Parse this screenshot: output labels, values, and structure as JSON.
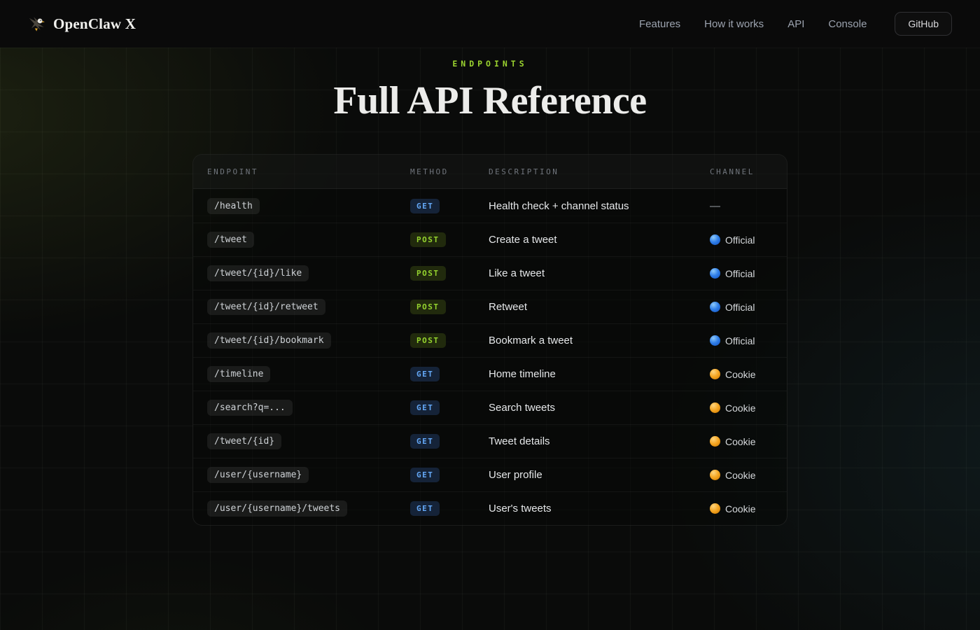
{
  "brand": {
    "name": "OpenClaw X"
  },
  "nav": {
    "links": [
      {
        "label": "Features"
      },
      {
        "label": "How it works"
      },
      {
        "label": "API"
      },
      {
        "label": "Console"
      }
    ],
    "github_label": "GitHub"
  },
  "hero": {
    "eyebrow": "ENDPOINTS",
    "title": "Full API Reference"
  },
  "table": {
    "columns": [
      "ENDPOINT",
      "METHOD",
      "DESCRIPTION",
      "CHANNEL"
    ],
    "rows": [
      {
        "endpoint": "/health",
        "method": "GET",
        "description": "Health check + channel status",
        "channel": "—",
        "channel_type": "none"
      },
      {
        "endpoint": "/tweet",
        "method": "POST",
        "description": "Create a tweet",
        "channel": "Official",
        "channel_type": "official"
      },
      {
        "endpoint": "/tweet/{id}/like",
        "method": "POST",
        "description": "Like a tweet",
        "channel": "Official",
        "channel_type": "official"
      },
      {
        "endpoint": "/tweet/{id}/retweet",
        "method": "POST",
        "description": "Retweet",
        "channel": "Official",
        "channel_type": "official"
      },
      {
        "endpoint": "/tweet/{id}/bookmark",
        "method": "POST",
        "description": "Bookmark a tweet",
        "channel": "Official",
        "channel_type": "official"
      },
      {
        "endpoint": "/timeline",
        "method": "GET",
        "description": "Home timeline",
        "channel": "Cookie",
        "channel_type": "cookie"
      },
      {
        "endpoint": "/search?q=...",
        "method": "GET",
        "description": "Search tweets",
        "channel": "Cookie",
        "channel_type": "cookie"
      },
      {
        "endpoint": "/tweet/{id}",
        "method": "GET",
        "description": "Tweet details",
        "channel": "Cookie",
        "channel_type": "cookie"
      },
      {
        "endpoint": "/user/{username}",
        "method": "GET",
        "description": "User profile",
        "channel": "Cookie",
        "channel_type": "cookie"
      },
      {
        "endpoint": "/user/{username}/tweets",
        "method": "GET",
        "description": "User's tweets",
        "channel": "Cookie",
        "channel_type": "cookie"
      }
    ]
  },
  "colors": {
    "accent_green": "#9bd32f",
    "get_badge_text": "#64a8f6",
    "get_badge_bg": "#152338",
    "post_badge_text": "#95d42e",
    "post_badge_bg": "#212a0d",
    "official_dot": "#2f7ee8",
    "cookie_dot": "#f5a623"
  }
}
